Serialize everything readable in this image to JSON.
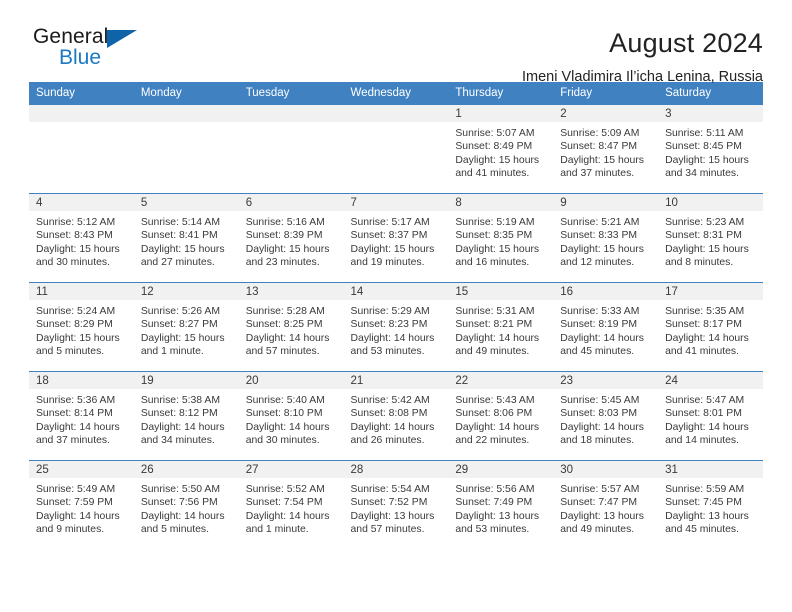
{
  "logo": {
    "word_one": "General",
    "word_two": "Blue",
    "accent_color": "#1b79c4",
    "triangle_color": "#0f63a8"
  },
  "header": {
    "title": "August 2024",
    "subtitle": "Imeni Vladimira Il’icha Lenina, Russia",
    "header_bg_color": "#3f81c1"
  },
  "weekday_headers": [
    "Sunday",
    "Monday",
    "Tuesday",
    "Wednesday",
    "Thursday",
    "Friday",
    "Saturday"
  ],
  "weeks": [
    [
      {
        "day": "",
        "empty": true
      },
      {
        "day": "",
        "empty": true
      },
      {
        "day": "",
        "empty": true
      },
      {
        "day": "",
        "empty": true
      },
      {
        "day": "1",
        "sunrise": "Sunrise: 5:07 AM",
        "sunset": "Sunset: 8:49 PM",
        "daylight1": "Daylight: 15 hours",
        "daylight2": "and 41 minutes."
      },
      {
        "day": "2",
        "sunrise": "Sunrise: 5:09 AM",
        "sunset": "Sunset: 8:47 PM",
        "daylight1": "Daylight: 15 hours",
        "daylight2": "and 37 minutes."
      },
      {
        "day": "3",
        "sunrise": "Sunrise: 5:11 AM",
        "sunset": "Sunset: 8:45 PM",
        "daylight1": "Daylight: 15 hours",
        "daylight2": "and 34 minutes."
      }
    ],
    [
      {
        "day": "4",
        "sunrise": "Sunrise: 5:12 AM",
        "sunset": "Sunset: 8:43 PM",
        "daylight1": "Daylight: 15 hours",
        "daylight2": "and 30 minutes."
      },
      {
        "day": "5",
        "sunrise": "Sunrise: 5:14 AM",
        "sunset": "Sunset: 8:41 PM",
        "daylight1": "Daylight: 15 hours",
        "daylight2": "and 27 minutes."
      },
      {
        "day": "6",
        "sunrise": "Sunrise: 5:16 AM",
        "sunset": "Sunset: 8:39 PM",
        "daylight1": "Daylight: 15 hours",
        "daylight2": "and 23 minutes."
      },
      {
        "day": "7",
        "sunrise": "Sunrise: 5:17 AM",
        "sunset": "Sunset: 8:37 PM",
        "daylight1": "Daylight: 15 hours",
        "daylight2": "and 19 minutes."
      },
      {
        "day": "8",
        "sunrise": "Sunrise: 5:19 AM",
        "sunset": "Sunset: 8:35 PM",
        "daylight1": "Daylight: 15 hours",
        "daylight2": "and 16 minutes."
      },
      {
        "day": "9",
        "sunrise": "Sunrise: 5:21 AM",
        "sunset": "Sunset: 8:33 PM",
        "daylight1": "Daylight: 15 hours",
        "daylight2": "and 12 minutes."
      },
      {
        "day": "10",
        "sunrise": "Sunrise: 5:23 AM",
        "sunset": "Sunset: 8:31 PM",
        "daylight1": "Daylight: 15 hours",
        "daylight2": "and 8 minutes."
      }
    ],
    [
      {
        "day": "11",
        "sunrise": "Sunrise: 5:24 AM",
        "sunset": "Sunset: 8:29 PM",
        "daylight1": "Daylight: 15 hours",
        "daylight2": "and 5 minutes."
      },
      {
        "day": "12",
        "sunrise": "Sunrise: 5:26 AM",
        "sunset": "Sunset: 8:27 PM",
        "daylight1": "Daylight: 15 hours",
        "daylight2": "and 1 minute."
      },
      {
        "day": "13",
        "sunrise": "Sunrise: 5:28 AM",
        "sunset": "Sunset: 8:25 PM",
        "daylight1": "Daylight: 14 hours",
        "daylight2": "and 57 minutes."
      },
      {
        "day": "14",
        "sunrise": "Sunrise: 5:29 AM",
        "sunset": "Sunset: 8:23 PM",
        "daylight1": "Daylight: 14 hours",
        "daylight2": "and 53 minutes."
      },
      {
        "day": "15",
        "sunrise": "Sunrise: 5:31 AM",
        "sunset": "Sunset: 8:21 PM",
        "daylight1": "Daylight: 14 hours",
        "daylight2": "and 49 minutes."
      },
      {
        "day": "16",
        "sunrise": "Sunrise: 5:33 AM",
        "sunset": "Sunset: 8:19 PM",
        "daylight1": "Daylight: 14 hours",
        "daylight2": "and 45 minutes."
      },
      {
        "day": "17",
        "sunrise": "Sunrise: 5:35 AM",
        "sunset": "Sunset: 8:17 PM",
        "daylight1": "Daylight: 14 hours",
        "daylight2": "and 41 minutes."
      }
    ],
    [
      {
        "day": "18",
        "sunrise": "Sunrise: 5:36 AM",
        "sunset": "Sunset: 8:14 PM",
        "daylight1": "Daylight: 14 hours",
        "daylight2": "and 37 minutes."
      },
      {
        "day": "19",
        "sunrise": "Sunrise: 5:38 AM",
        "sunset": "Sunset: 8:12 PM",
        "daylight1": "Daylight: 14 hours",
        "daylight2": "and 34 minutes."
      },
      {
        "day": "20",
        "sunrise": "Sunrise: 5:40 AM",
        "sunset": "Sunset: 8:10 PM",
        "daylight1": "Daylight: 14 hours",
        "daylight2": "and 30 minutes."
      },
      {
        "day": "21",
        "sunrise": "Sunrise: 5:42 AM",
        "sunset": "Sunset: 8:08 PM",
        "daylight1": "Daylight: 14 hours",
        "daylight2": "and 26 minutes."
      },
      {
        "day": "22",
        "sunrise": "Sunrise: 5:43 AM",
        "sunset": "Sunset: 8:06 PM",
        "daylight1": "Daylight: 14 hours",
        "daylight2": "and 22 minutes."
      },
      {
        "day": "23",
        "sunrise": "Sunrise: 5:45 AM",
        "sunset": "Sunset: 8:03 PM",
        "daylight1": "Daylight: 14 hours",
        "daylight2": "and 18 minutes."
      },
      {
        "day": "24",
        "sunrise": "Sunrise: 5:47 AM",
        "sunset": "Sunset: 8:01 PM",
        "daylight1": "Daylight: 14 hours",
        "daylight2": "and 14 minutes."
      }
    ],
    [
      {
        "day": "25",
        "sunrise": "Sunrise: 5:49 AM",
        "sunset": "Sunset: 7:59 PM",
        "daylight1": "Daylight: 14 hours",
        "daylight2": "and 9 minutes."
      },
      {
        "day": "26",
        "sunrise": "Sunrise: 5:50 AM",
        "sunset": "Sunset: 7:56 PM",
        "daylight1": "Daylight: 14 hours",
        "daylight2": "and 5 minutes."
      },
      {
        "day": "27",
        "sunrise": "Sunrise: 5:52 AM",
        "sunset": "Sunset: 7:54 PM",
        "daylight1": "Daylight: 14 hours",
        "daylight2": "and 1 minute."
      },
      {
        "day": "28",
        "sunrise": "Sunrise: 5:54 AM",
        "sunset": "Sunset: 7:52 PM",
        "daylight1": "Daylight: 13 hours",
        "daylight2": "and 57 minutes."
      },
      {
        "day": "29",
        "sunrise": "Sunrise: 5:56 AM",
        "sunset": "Sunset: 7:49 PM",
        "daylight1": "Daylight: 13 hours",
        "daylight2": "and 53 minutes."
      },
      {
        "day": "30",
        "sunrise": "Sunrise: 5:57 AM",
        "sunset": "Sunset: 7:47 PM",
        "daylight1": "Daylight: 13 hours",
        "daylight2": "and 49 minutes."
      },
      {
        "day": "31",
        "sunrise": "Sunrise: 5:59 AM",
        "sunset": "Sunset: 7:45 PM",
        "daylight1": "Daylight: 13 hours",
        "daylight2": "and 45 minutes."
      }
    ]
  ]
}
